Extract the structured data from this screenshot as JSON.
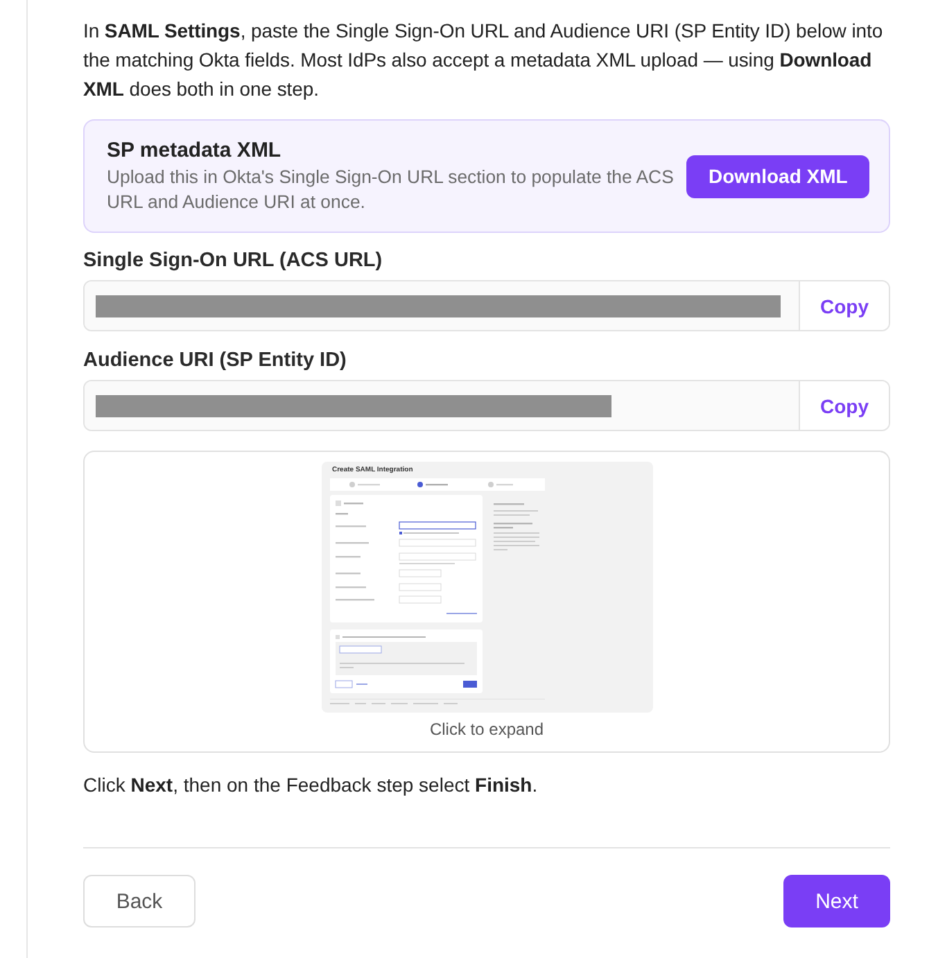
{
  "intro": "In **SAML Settings**, paste the Single Sign-On URL and Audience URI (SP Entity ID) below into the matching Okta fields. Most IdPs also accept a metadata XML upload — using **Download XML** does both in one step.",
  "metadata_card": {
    "title": "SP metadata XML",
    "description": "Upload this in Okta's Single Sign-On URL section to populate the ACS URL and Audience URI at once.",
    "button": "Download XML"
  },
  "fields": [
    {
      "label": "Single Sign-On URL (ACS URL)",
      "button": "Copy"
    },
    {
      "label": "Audience URI (SP Entity ID)",
      "button": "Copy"
    }
  ],
  "screenshot": {
    "title": "Create SAML Integration",
    "caption": "Click to expand"
  },
  "instruction": "Click **Next**, then on the Feedback step select **Finish**.",
  "buttons": {
    "back": "Back",
    "next": "Next"
  }
}
